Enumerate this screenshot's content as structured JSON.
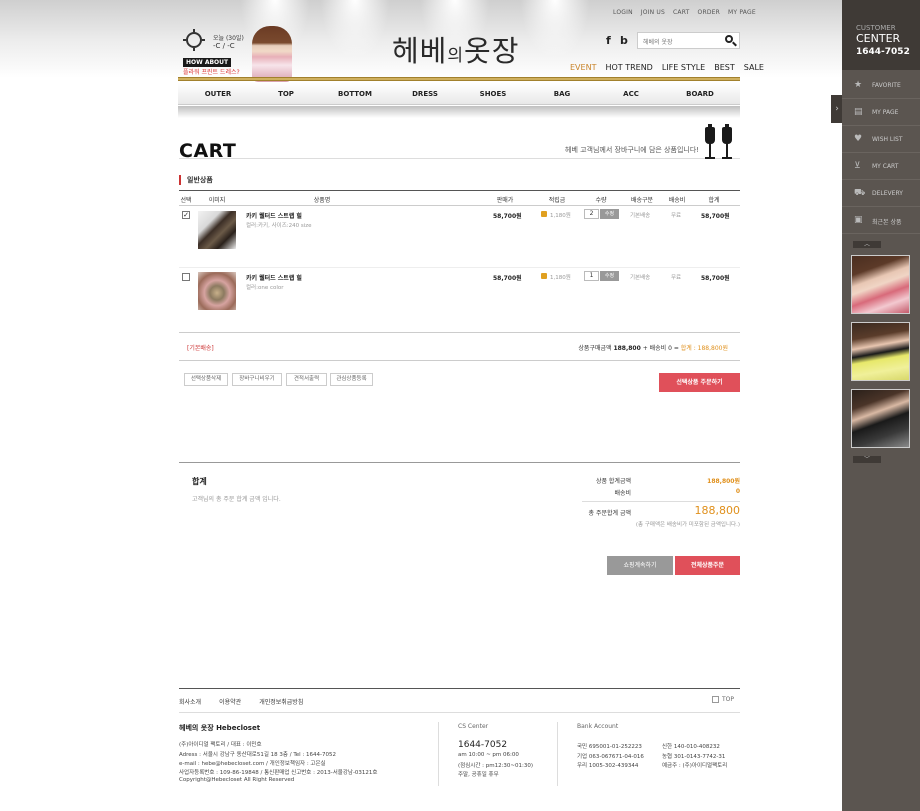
{
  "header": {
    "top_links": [
      "LOGIN",
      "JOIN US",
      "CART",
      "ORDER",
      "MY PAGE"
    ],
    "weather_text1": "오늘 (30일)",
    "weather_text2": "-C / -C",
    "how_about": "HOW ABOUT",
    "how_sub": "플라워 프린트 드레스?",
    "logo_main": "헤베",
    "logo_mid": "의",
    "logo_end": "옷장",
    "social_f": "f",
    "social_b": "b",
    "search_placeholder": "헤베의 옷장",
    "category_nav": [
      "EVENT",
      "HOT TREND",
      "LIFE STYLE",
      "BEST",
      "SALE"
    ],
    "main_nav": [
      "OUTER",
      "TOP",
      "BOTTOM",
      "DRESS",
      "SHOES",
      "BAG",
      "ACC",
      "BOARD"
    ]
  },
  "cart": {
    "title": "CART",
    "subtitle": "헤베 고객님께서 장바구니에 담은 상품입니다!",
    "section_title": "일반상품",
    "columns": [
      "선택",
      "이미지",
      "상품명",
      "판매가",
      "적립금",
      "수량",
      "배송구분",
      "배송비",
      "합계"
    ],
    "items": [
      {
        "checked": true,
        "name": "카키 웰터드 스트랩 힐",
        "option": "컬러:카키, 사이즈:240 size",
        "price": "58,700원",
        "points": "1,180원",
        "qty": "2",
        "qty_btn": "수정",
        "ship": "기본배송",
        "fee": "무료",
        "total": "58,700원"
      },
      {
        "checked": false,
        "name": "카키 웰터드 스트랩 힐",
        "option": "컬러:one color",
        "price": "58,700원",
        "points": "1,180원",
        "qty": "1",
        "qty_btn": "수정",
        "ship": "기본배송",
        "fee": "무료",
        "total": "58,700원"
      }
    ],
    "basic_ship_label": "[기본배송]",
    "summary_prefix": "상품구매금액",
    "summary_amount": "188,800",
    "summary_mid": "+ 배송비 0 =",
    "summary_total_label": "합계 : 188,800원",
    "buttons": [
      "선택상품삭제",
      "장바구니비우기",
      "견적서출력",
      "관심상품등록"
    ],
    "order_selected": "선택상품 주문하기"
  },
  "totals": {
    "label": "합계",
    "desc": "고객님의 총 주문 합계 금액 입니다.",
    "goods_total_label": "상품 합계금액",
    "goods_total_value": "188,800원",
    "shipping_label": "배송비",
    "shipping_value": "0",
    "order_total_label": "총 주문합계 금액",
    "order_total_value": "188,800",
    "note": "(총 구매액은 배송비가 미포함된 금액입니다.)",
    "continue_btn": "쇼핑계속하기",
    "order_all_btn": "전체상품주문"
  },
  "footer": {
    "links": [
      "회사소개",
      "이용약관",
      "개인정보취급방침"
    ],
    "top_label": "TOP",
    "company": "헤베의 옷장 Hebecloset",
    "info": [
      "(주)아이디얼 팩토리  /  대표 : 이민호",
      "Adress : 서울시 강남구 동산대로51길 18 3층  /  Tel : 1644-7052",
      "e-mail : hebe@hebecloset.com  /  개인정보책임자 : 고은실",
      "사업자등록번호 : 109-86-19848  /  통신판매업 신고번호 : 2013-서울강남-03121호",
      "Copyright@Hebecloset All Right Reserved"
    ],
    "cs_label": "CS Center",
    "cs_phone": "1644-7052",
    "cs_info": [
      "am 10:00 ~ pm 06:00",
      "(점심시간 : pm12:30~01:30)",
      "주말, 공휴일 휴무"
    ],
    "bank_label": "Bank Account",
    "banks_left": [
      "국민 695001-01-252223",
      "기업 063-067671-04-016",
      "우리 1005-302-439344"
    ],
    "banks_right": [
      "신한 140-010-408232",
      "농협 301-0143-7742-31",
      "예금주 : (주)아이디얼팩토리"
    ]
  },
  "sidebar": {
    "cc1": "CUSTOMER",
    "cc2": "CENTER",
    "cc3": "1644-7052",
    "tab_arrow": "›",
    "items": [
      {
        "icon": "star-icon",
        "glyph": "★",
        "label": "FAVORITE"
      },
      {
        "icon": "mypage-icon",
        "glyph": "▤",
        "label": "MY PAGE"
      },
      {
        "icon": "heart-icon",
        "glyph": "♥",
        "label": "WISH LIST"
      },
      {
        "icon": "cart-icon",
        "glyph": "⊻",
        "label": "MY CART"
      },
      {
        "icon": "truck-icon",
        "glyph": "⛟",
        "label": "DELEVERY"
      },
      {
        "icon": "image-icon",
        "glyph": "▣",
        "label": "최근본 상품"
      }
    ],
    "up_arrow": "︿",
    "down_arrow": "﹀"
  }
}
